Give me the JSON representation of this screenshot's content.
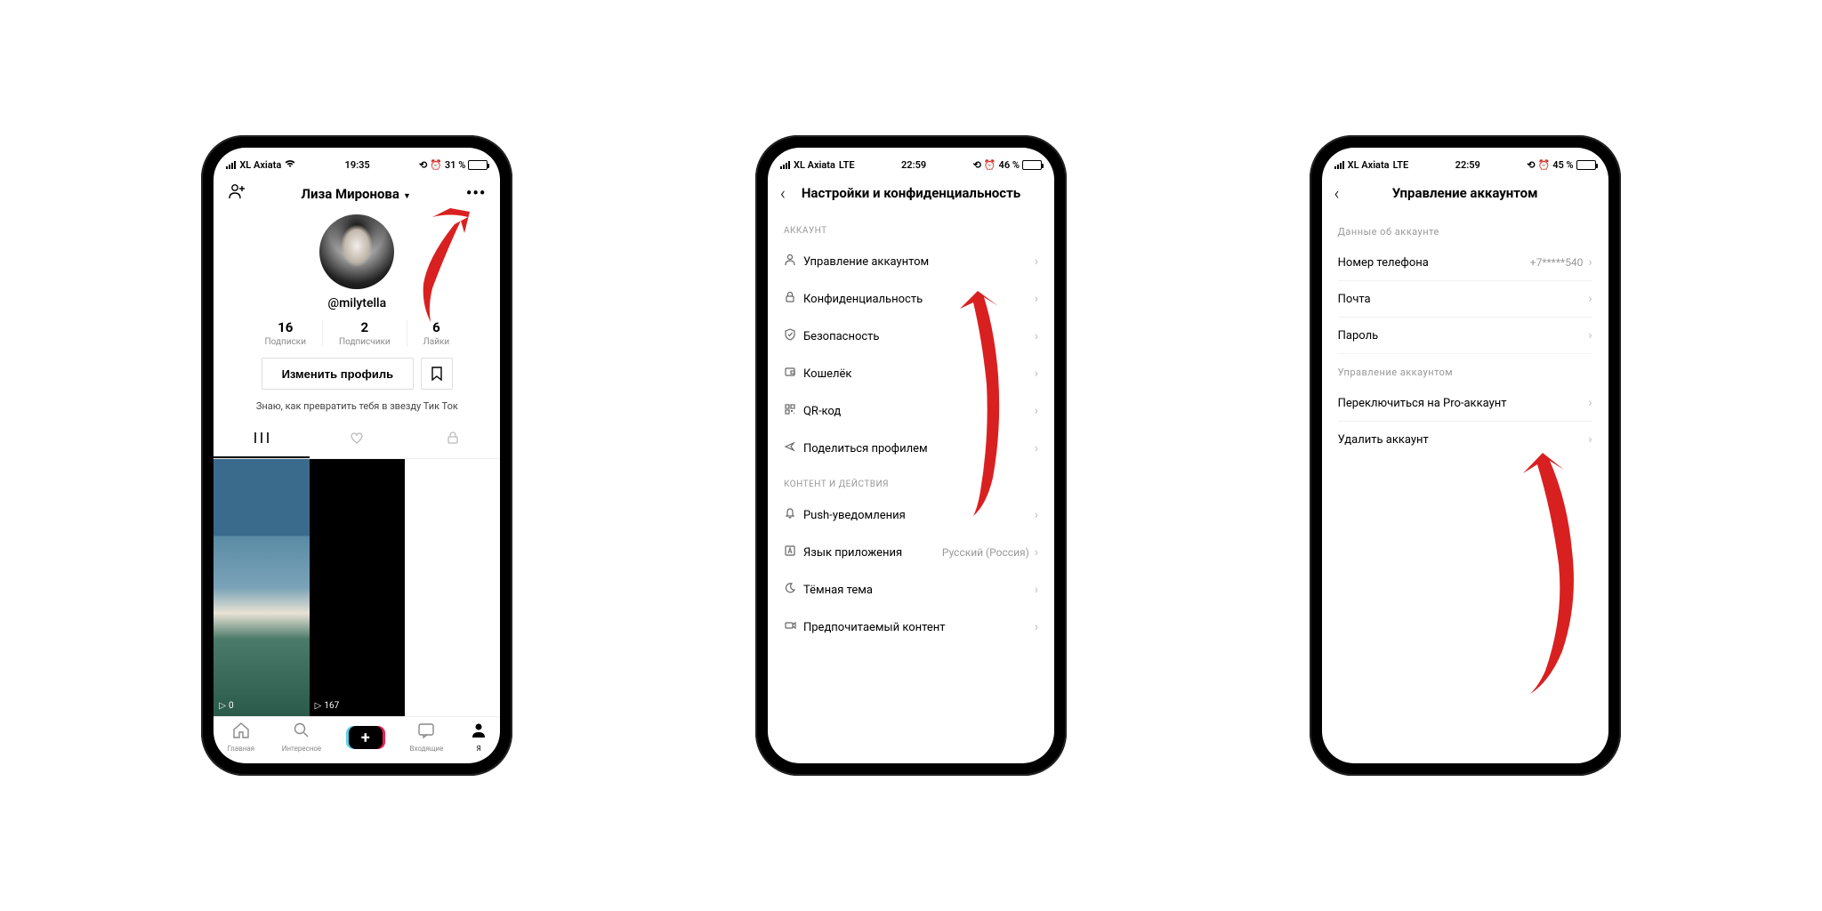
{
  "phone1": {
    "status": {
      "carrier": "XL Axiata",
      "net_icon": "wifi",
      "time": "19:35",
      "alarm": true,
      "battery_text": "31 %",
      "battery_pct": 31
    },
    "header": {
      "display_name": "Лиза Миронова",
      "more_icon": "menu-dots"
    },
    "username": "@milytella",
    "stats": [
      {
        "num": "16",
        "label": "Подписки"
      },
      {
        "num": "2",
        "label": "Подписчики"
      },
      {
        "num": "6",
        "label": "Лайки"
      }
    ],
    "edit_profile_label": "Изменить профиль",
    "bio": "Знаю, как превратить тебя в звезду Тик Ток",
    "videos": [
      {
        "plays": "0"
      },
      {
        "plays": "167"
      }
    ],
    "bottom_nav": [
      {
        "label": "Главная",
        "icon": "home"
      },
      {
        "label": "Интересное",
        "icon": "search"
      },
      {
        "label": "",
        "icon": "plus"
      },
      {
        "label": "Входящие",
        "icon": "inbox"
      },
      {
        "label": "Я",
        "icon": "profile"
      }
    ]
  },
  "phone2": {
    "status": {
      "carrier": "XL Axiata",
      "net_text": "LTE",
      "time": "22:59",
      "alarm": true,
      "battery_text": "46 %",
      "battery_pct": 46
    },
    "header_title": "Настройки и конфиденциальность",
    "section1_label": "АККАУНТ",
    "section1_items": [
      {
        "icon": "person",
        "label": "Управление аккаунтом"
      },
      {
        "icon": "lock",
        "label": "Конфиденциальность"
      },
      {
        "icon": "shield",
        "label": "Безопасность"
      },
      {
        "icon": "wallet",
        "label": "Кошелёк"
      },
      {
        "icon": "qr",
        "label": "QR-код"
      },
      {
        "icon": "share",
        "label": "Поделиться профилем"
      }
    ],
    "section2_label": "КОНТЕНТ И ДЕЙСТВИЯ",
    "section2_items": [
      {
        "icon": "bell",
        "label": "Push-уведомления"
      },
      {
        "icon": "lang",
        "label": "Язык приложения",
        "value": "Русский (Россия)"
      },
      {
        "icon": "moon",
        "label": "Тёмная тема"
      },
      {
        "icon": "video",
        "label": "Предпочитаемый контент"
      }
    ]
  },
  "phone3": {
    "status": {
      "carrier": "XL Axiata",
      "net_text": "LTE",
      "time": "22:59",
      "alarm": true,
      "battery_text": "45 %",
      "battery_pct": 45
    },
    "header_title": "Управление аккаунтом",
    "section1_label": "Данные об аккаунте",
    "section1_items": [
      {
        "label": "Номер телефона",
        "value": "+7*****540"
      },
      {
        "label": "Почта"
      },
      {
        "label": "Пароль"
      }
    ],
    "section2_label": "Управление аккаунтом",
    "section2_items": [
      {
        "label": "Переключиться на Pro-аккаунт"
      },
      {
        "label": "Удалить аккаунт"
      }
    ]
  }
}
